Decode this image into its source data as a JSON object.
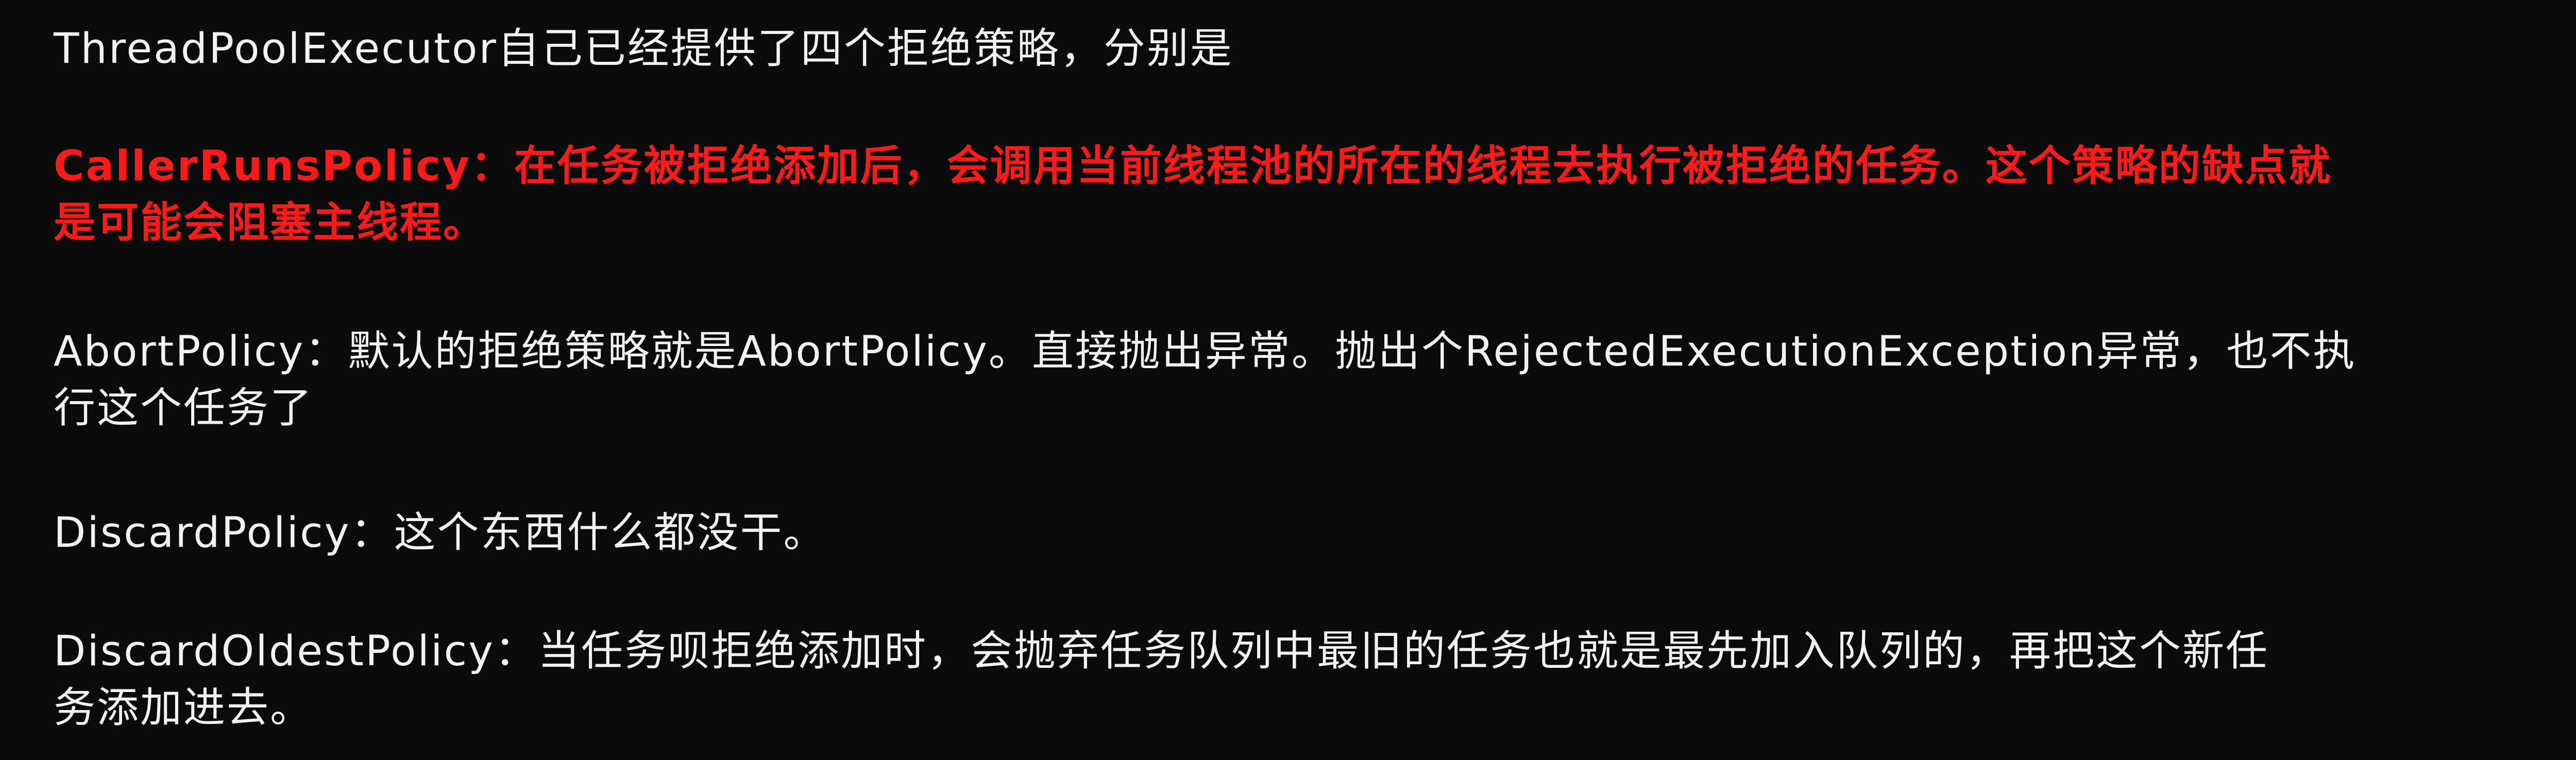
{
  "intro": {
    "line1": "ThreadPoolExecutor自己已经提供了四个拒绝策略，分别是"
  },
  "policies": [
    {
      "line1": "CallerRunsPolicy：在任务被拒绝添加后，会调用当前线程池的所在的线程去执行被拒绝的任务。这个策略的缺点就",
      "line2": "是可能会阻塞主线程。",
      "color": "#ff1a1a"
    },
    {
      "line1": "AbortPolicy：默认的拒绝策略就是AbortPolicy。直接抛出异常。抛出个RejectedExecutionException异常，也不执",
      "line2": "行这个任务了",
      "color": "#f2f2f2"
    },
    {
      "line1": "DiscardPolicy：这个东西什么都没干。",
      "color": "#f2f2f2"
    },
    {
      "line1": "DiscardOldestPolicy：当任务呗拒绝添加时，会抛弃任务队列中最旧的任务也就是最先加入队列的，再把这个新任",
      "line2": "务添加进去。",
      "color": "#f2f2f2"
    }
  ]
}
